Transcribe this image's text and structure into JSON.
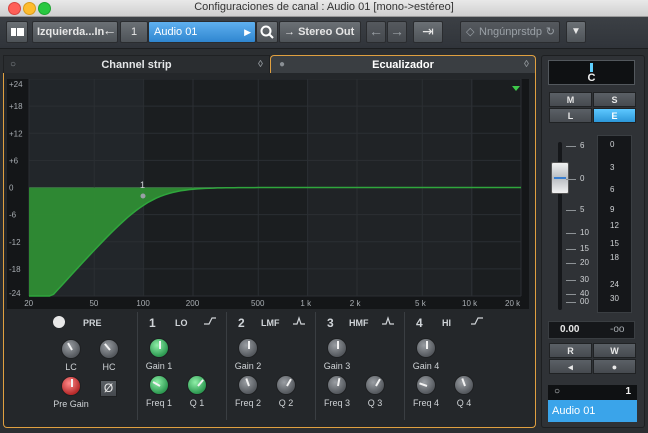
{
  "window": {
    "title": "Configuraciones de canal : Audio 01 [mono->estéreo]",
    "traffic_colors": [
      "#ff5f57",
      "#febc2e",
      "#28c840"
    ]
  },
  "toolbar": {
    "input_routing": "Izquierda...In",
    "channel_number": "1",
    "channel_name": "Audio 01",
    "output_routing": "Stereo Out",
    "preset_label": "Nngúnprstdp"
  },
  "tabs": {
    "channel_strip": "Channel strip",
    "equalizer": "Ecualizador"
  },
  "eq_graph": {
    "y_labels": [
      "+24",
      "+18",
      "+12",
      "+6",
      "0",
      "-6",
      "-12",
      "-18",
      "-24"
    ],
    "x_labels": [
      "20",
      "50",
      "100",
      "200",
      "500",
      "1 k",
      "2 k",
      "5 k",
      "10 k",
      "20 k"
    ],
    "band_marker": "1",
    "curve_color": "#2fa63c"
  },
  "bands": {
    "pre": {
      "label": "PRE",
      "lc": "LC",
      "hc": "HC",
      "pre_gain": "Pre Gain"
    },
    "b1": {
      "num": "1",
      "type": "LO",
      "gain": "Gain 1",
      "freq": "Freq 1",
      "q": "Q 1"
    },
    "b2": {
      "num": "2",
      "type": "LMF",
      "gain": "Gain 2",
      "freq": "Freq 2",
      "q": "Q 2"
    },
    "b3": {
      "num": "3",
      "type": "HMF",
      "gain": "Gain 3",
      "freq": "Freq 3",
      "q": "Q 3"
    },
    "b4": {
      "num": "4",
      "type": "HI",
      "gain": "Gain 4",
      "freq": "Freq 4",
      "q": "Q 4"
    }
  },
  "strip": {
    "pan_value": "C",
    "buttons": {
      "m": "M",
      "s": "S",
      "l": "L",
      "e": "E",
      "r": "R",
      "w": "W"
    },
    "fader_scale": [
      "6",
      "0",
      "5",
      "10",
      "15",
      "20",
      "30",
      "40",
      "00"
    ],
    "meter_scale": [
      "0",
      "3",
      "6",
      "9",
      "12",
      "15",
      "18",
      "24",
      "30"
    ],
    "level": "0.00",
    "peak": "-oo",
    "channel_index": "1",
    "channel_name": "Audio 01"
  }
}
